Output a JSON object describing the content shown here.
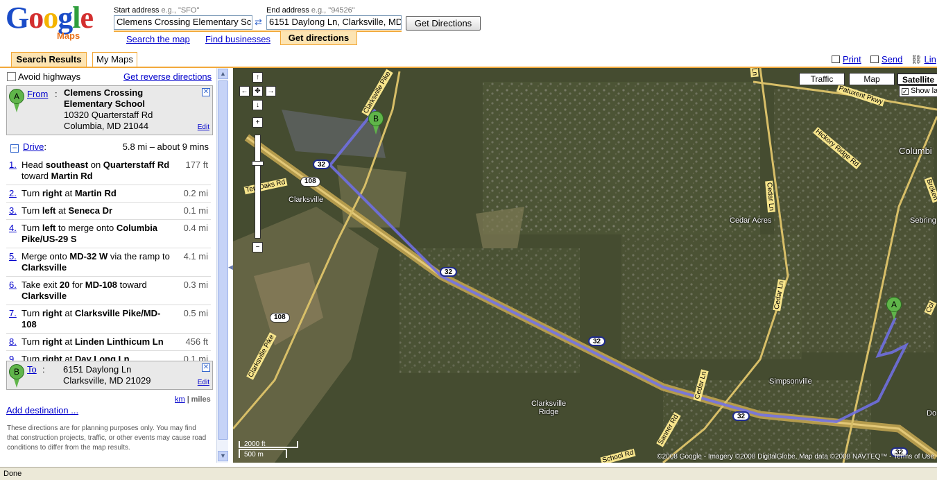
{
  "header": {
    "logo_google": "Google",
    "logo_maps": "Maps",
    "start_label": "Start address",
    "start_eg": "e.g., \"SFO\"",
    "start_value": "Clemens Crossing Elementary Sc",
    "end_label": "End address",
    "end_eg": "e.g., \"94526\"",
    "end_value": "6151 Daylong Ln, Clarksville, MD",
    "get_directions_button": "Get Directions",
    "tabs": [
      "Search the map",
      "Find businesses",
      "Get directions"
    ]
  },
  "left_tabs": [
    "Search Results",
    "My Maps"
  ],
  "top_links": [
    "Print",
    "Send",
    "Lin"
  ],
  "panel": {
    "avoid_highways": "Avoid highways",
    "reverse": "Get reverse directions",
    "from": {
      "pin": "A",
      "label": "From",
      "name": "Clemens Crossing Elementary School",
      "addr1": "10320 Quarterstaff Rd",
      "addr2": "Columbia, MD 21044",
      "edit": "Edit",
      "close": "✕"
    },
    "drive": {
      "label": "Drive",
      "summary": "5.8 mi – about 9 mins"
    },
    "steps": [
      {
        "num": "1.",
        "html": "Head <b>southeast</b> on <b>Quarterstaff Rd</b> toward <b>Martin Rd</b>",
        "dist": "177 ft"
      },
      {
        "num": "2.",
        "html": "Turn <b>right</b> at <b>Martin Rd</b>",
        "dist": "0.2 mi"
      },
      {
        "num": "3.",
        "html": "Turn <b>left</b> at <b>Seneca Dr</b>",
        "dist": "0.1 mi"
      },
      {
        "num": "4.",
        "html": "Turn <b>left</b> to merge onto <b>Columbia Pike/US-29 S</b>",
        "dist": "0.4 mi"
      },
      {
        "num": "5.",
        "html": "Merge onto <b>MD-32 W</b> via the ramp to <b>Clarksville</b>",
        "dist": "4.1 mi"
      },
      {
        "num": "6.",
        "html": "Take exit <b>20</b> for <b>MD-108</b> toward <b>Clarksville</b>",
        "dist": "0.3 mi"
      },
      {
        "num": "7.",
        "html": "Turn <b>right</b> at <b>Clarksville Pike/MD-108</b>",
        "dist": "0.5 mi"
      },
      {
        "num": "8.",
        "html": "Turn <b>right</b> at <b>Linden Linthicum Ln</b>",
        "dist": "456 ft"
      },
      {
        "num": "9.",
        "html": "Turn <b>right</b> at <b>Day Long Ln</b>",
        "dist": "0.1 mi"
      }
    ],
    "to": {
      "pin": "B",
      "label": "To",
      "addr1": "6151 Daylong Ln",
      "addr2": "Clarksville, MD 21029",
      "edit": "Edit",
      "close": "✕"
    },
    "units_km": "km",
    "units_sep": "|",
    "units_miles": "miles",
    "add_destination": "Add destination ...",
    "disclaimer": "These directions are for planning purposes only. You may find that construction projects, traffic, or other events may cause road conditions to differ from the map results."
  },
  "map": {
    "buttons": [
      "Traffic",
      "Map",
      "Satellite"
    ],
    "show_labels": "Show la",
    "labels": {
      "clarksville": "Clarksville",
      "cedar_acres": "Cedar Acres",
      "simpsonville": "Simpsonville",
      "clarksville_ridge": "Clarksville\nRidge",
      "columbia": "Columbi",
      "sebring": "Sebring",
      "do": "Do"
    },
    "road_labels": {
      "clarksville_pike_top": "Clarksville Pike",
      "clarksville_pike_left": "Clarksville Pike",
      "ten_oaks": "Ten Oaks Rd",
      "cedar_ln_top": "Cedar Ln",
      "cedar_ln_mid": "Cedar Ln",
      "cedar_ln_low": "Cedar Ln",
      "patuxent": "Patuxent Pkwy",
      "hickory": "Hickory Ridge Rd",
      "broken": "Broken",
      "sanner": "Sanner Rd",
      "school": "School Rd",
      "col": "Col",
      "top_ln": "Ln"
    },
    "shields": {
      "s32a": "32",
      "s32b": "32",
      "s32c": "32",
      "s32d": "32",
      "s32e": "32",
      "s108a": "108",
      "s108b": "108"
    },
    "marker_a": "A",
    "marker_b": "B",
    "scale_ft": "2000 ft",
    "scale_m": "500 m",
    "copyright": "©2008 Google - Imagery ©2008 DigitalGlobe, Map data ©2008 NAVTEQ™ - Terms of Use"
  },
  "status": "Done"
}
